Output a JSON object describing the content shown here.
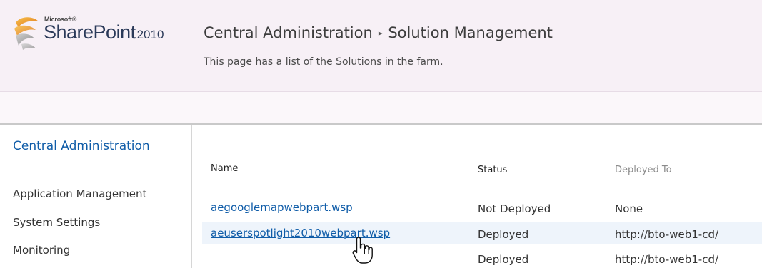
{
  "header": {
    "logo": {
      "microsoft": "Microsoft®",
      "product": "SharePoint",
      "version": "2010"
    },
    "breadcrumb": {
      "root": "Central Administration",
      "separator": "▸",
      "current": "Solution Management"
    },
    "description": "This page has a list of the Solutions in the farm."
  },
  "leftnav": {
    "heading": "Central Administration",
    "items": [
      {
        "label": "Application Management"
      },
      {
        "label": "System Settings"
      },
      {
        "label": "Monitoring"
      }
    ]
  },
  "table": {
    "columns": {
      "name": "Name",
      "status": "Status",
      "deployed_to": "Deployed To"
    },
    "rows": [
      {
        "name": "aegooglemapwebpart.wsp",
        "status": "Not Deployed",
        "deployed_to": "None"
      },
      {
        "name": "aeuserspotlight2010webpart.wsp",
        "status": "Deployed",
        "deployed_to": "http://bto-web1-cd/"
      },
      {
        "name": "",
        "status": "Deployed",
        "deployed_to": "http://bto-web1-cd/"
      }
    ]
  },
  "colors": {
    "header_bg": "#f7f0f6",
    "link": "#0f5ca8",
    "text": "#333333",
    "muted": "#8b8b8b"
  },
  "icons": {
    "logo": "sharepoint-logo-icon",
    "cursor": "hand-pointer-icon"
  }
}
